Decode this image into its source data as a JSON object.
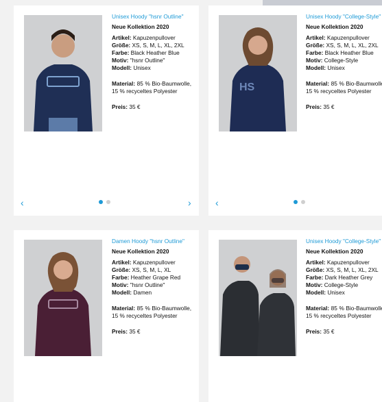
{
  "colors": {
    "accent": "#1e9ad6",
    "inactive_dot": "#cfcfcf"
  },
  "icons": {
    "prev": "chevron-left-icon",
    "next": "chevron-right-icon"
  },
  "carousel": {
    "prev_symbol": "‹",
    "next_symbol": "›",
    "active_index": 0,
    "dot_count": 2
  },
  "products": [
    {
      "title": "Unisex Hoody \"hsnr Outline\"",
      "collection": "Neue Kollektion 2020",
      "artikel_label": "Artikel:",
      "artikel": "Kapuzenpullover",
      "groesse_label": "Größe:",
      "groesse": "XS, S, M, L, XL, 2XL",
      "farbe_label": "Farbe:",
      "farbe": "Black Heather Blue",
      "motiv_label": "Motiv:",
      "motiv": "\"hsnr Outline\"",
      "modell_label": "Modell:",
      "modell": "Unisex",
      "material_label": "Material:",
      "material": "85 % Bio-Baumwolle, 15 % recyceltes Polyester",
      "preis_label": "Preis:",
      "preis": "35 €"
    },
    {
      "title": "Unisex Hoody \"College-Style\"",
      "collection": "Neue Kollektion 2020",
      "artikel_label": "Artikel:",
      "artikel": "Kapuzenpullover",
      "groesse_label": "Größe:",
      "groesse": "XS, S, M, L, XL, 2XL",
      "farbe_label": "Farbe:",
      "farbe": "Black Heather Blue",
      "motiv_label": "Motiv:",
      "motiv": "College-Style",
      "modell_label": "Modell:",
      "modell": "Unisex",
      "material_label": "Material:",
      "material": "85 % Bio-Baumwolle, 15 % recyceltes Polyester",
      "preis_label": "Preis:",
      "preis": "35 €"
    },
    {
      "title": "Damen Hoody \"hsnr Outline\"",
      "collection": "Neue Kollektion 2020",
      "artikel_label": "Artikel:",
      "artikel": "Kapuzenpullover",
      "groesse_label": "Größe:",
      "groesse": "XS, S, M, L, XL",
      "farbe_label": "Farbe:",
      "farbe": "Heather Grape Red",
      "motiv_label": "Motiv:",
      "motiv": "\"hsnr Outline\"",
      "modell_label": "Modell:",
      "modell": "Damen",
      "material_label": "Material:",
      "material": "85 % Bio-Baumwolle, 15 % recyceltes Polyester",
      "preis_label": "Preis:",
      "preis": "35 €"
    },
    {
      "title": "Unisex Hoody \"College-Style\"",
      "collection": "Neue Kollektion 2020",
      "artikel_label": "Artikel:",
      "artikel": "Kapuzenpullover",
      "groesse_label": "Größe:",
      "groesse": "XS, S, M, L, XL, 2XL",
      "farbe_label": "Farbe:",
      "farbe": "Dark Heather Grey",
      "motiv_label": "Motiv:",
      "motiv": "College-Style",
      "modell_label": "Modell:",
      "modell": "Unisex",
      "material_label": "Material:",
      "material": "85 % Bio-Baumwolle, 15 % recyceltes Polyester",
      "preis_label": "Preis:",
      "preis": "35 €"
    }
  ]
}
